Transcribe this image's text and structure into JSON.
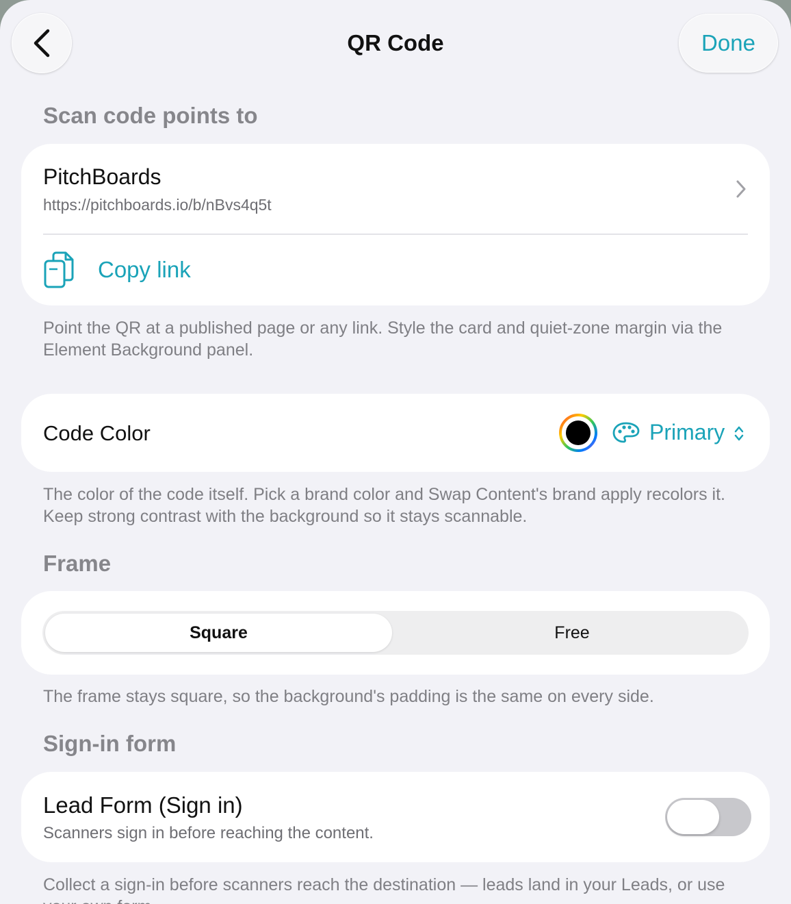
{
  "header": {
    "title": "QR Code",
    "done_label": "Done"
  },
  "target_section": {
    "label": "Scan code points to",
    "name": "PitchBoards",
    "url": "https://pitchboards.io/b/nBvs4q5t",
    "copy_label": "Copy link",
    "footnote": "Point the QR at a published page or any link. Style the card and quiet-zone margin via the Element Background panel."
  },
  "code_color": {
    "label": "Code Color",
    "selected": "Primary",
    "swatch_color": "#000000",
    "accent": "#1aa3b8",
    "footnote": "The color of the code itself. Pick a brand color and Swap Content's brand apply recolors it. Keep strong contrast with the background so it stays scannable."
  },
  "frame": {
    "label": "Frame",
    "options": [
      "Square",
      "Free"
    ],
    "selected_index": 0,
    "footnote": "The frame stays square, so the background's padding is the same on every side."
  },
  "signin": {
    "label": "Sign-in form",
    "title": "Lead Form (Sign in)",
    "subtitle": "Scanners sign in before reaching the content.",
    "enabled": false,
    "footnote": "Collect a sign-in before scanners reach the destination — leads land in your Leads, or use your own form."
  },
  "icons": {
    "back": "chevron-left-icon",
    "target_chevron": "chevron-right-icon",
    "copy": "copy-documents-icon",
    "color_wheel": "color-wheel-icon",
    "palette": "palette-icon",
    "updown": "chevron-up-down-icon"
  }
}
